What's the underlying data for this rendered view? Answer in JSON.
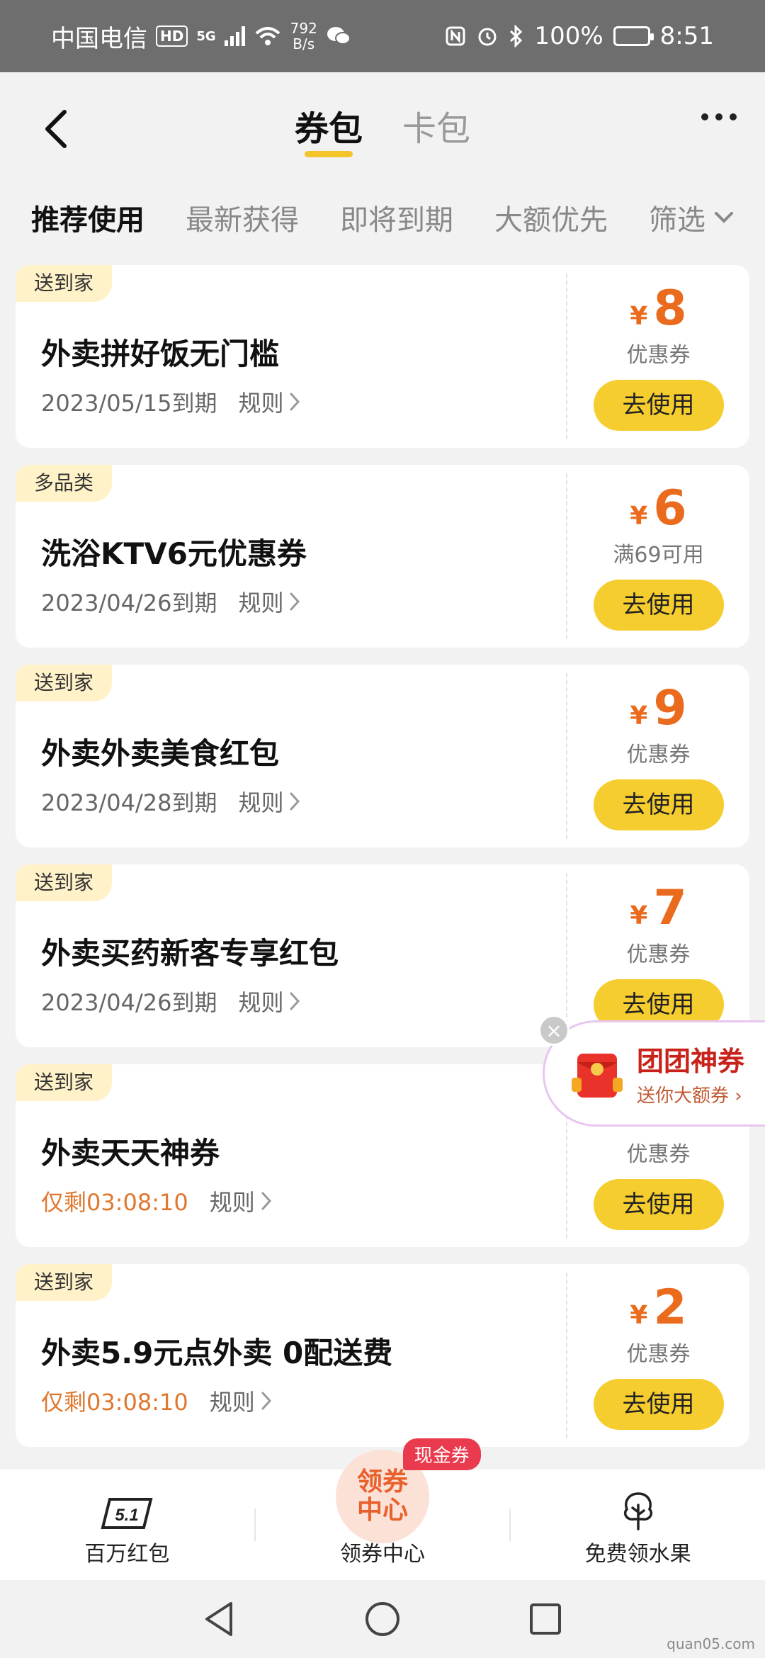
{
  "status_bar": {
    "carrier": "中国电信",
    "hd": "HD",
    "net": "5G",
    "speed_value": "792",
    "speed_unit": "B/s",
    "battery": "100%",
    "time": "8:51"
  },
  "header": {
    "tabs": [
      "券包",
      "卡包"
    ],
    "active_tab": "券包"
  },
  "filters": {
    "items": [
      "推荐使用",
      "最新获得",
      "即将到期",
      "大额优先"
    ],
    "dropdown_label": "筛选"
  },
  "coupons": [
    {
      "tag": "送到家",
      "title": "外卖拼好饭无门槛",
      "subtitle": "2023/05/15到期",
      "rule": "规则",
      "currency": "¥",
      "amount": "8",
      "type": "优惠券",
      "button": "去使用"
    },
    {
      "tag": "多品类",
      "title": "洗浴KTV6元优惠券",
      "subtitle": "2023/04/26到期",
      "rule": "规则",
      "currency": "¥",
      "amount": "6",
      "type": "满69可用",
      "button": "去使用"
    },
    {
      "tag": "送到家",
      "title": "外卖外卖美食红包",
      "subtitle": "2023/04/28到期",
      "rule": "规则",
      "currency": "¥",
      "amount": "9",
      "type": "优惠券",
      "button": "去使用"
    },
    {
      "tag": "送到家",
      "title": "外卖买药新客专享红包",
      "subtitle": "2023/04/26到期",
      "rule": "规则",
      "currency": "¥",
      "amount": "7",
      "type": "优惠券",
      "button": "去使用"
    },
    {
      "tag": "送到家",
      "title": "外卖天天神券",
      "subtitle": "仅剩03:08:10",
      "rule": "规则",
      "currency": "",
      "amount": "",
      "type": "优惠券",
      "button": "去使用"
    },
    {
      "tag": "送到家",
      "title": "外卖5.9元点外卖 0配送费",
      "subtitle": "仅剩03:08:10",
      "rule": "规则",
      "currency": "¥",
      "amount": "2",
      "type": "优惠券",
      "button": "去使用"
    }
  ],
  "floating_banner": {
    "title": "团团神券",
    "subtitle": "送你大额券",
    "close": "×"
  },
  "bottom_nav": {
    "items": [
      {
        "label": "百万红包",
        "icon": "5-1-icon"
      },
      {
        "label": "领券中心",
        "icon": "coupon-center-icon",
        "circle_line1": "领券",
        "circle_line2": "中心",
        "badge": "现金券"
      },
      {
        "label": "免费领水果",
        "icon": "tree-icon"
      }
    ]
  },
  "watermark": "quan05.com"
}
